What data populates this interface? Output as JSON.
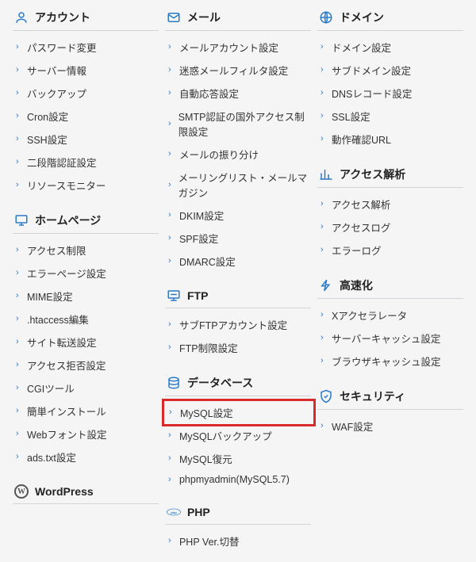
{
  "columns": [
    {
      "sections": [
        {
          "id": "account",
          "icon": "person",
          "title": "アカウント",
          "items": [
            "パスワード変更",
            "サーバー情報",
            "バックアップ",
            "Cron設定",
            "SSH設定",
            "二段階認証設定",
            "リソースモニター"
          ]
        },
        {
          "id": "homepage",
          "icon": "monitor",
          "title": "ホームページ",
          "items": [
            "アクセス制限",
            "エラーページ設定",
            "MIME設定",
            ".htaccess編集",
            "サイト転送設定",
            "アクセス拒否設定",
            "CGIツール",
            "簡単インストール",
            "Webフォント設定",
            "ads.txt設定"
          ]
        },
        {
          "id": "wordpress",
          "icon": "wordpress",
          "title": "WordPress",
          "items": []
        }
      ]
    },
    {
      "sections": [
        {
          "id": "mail",
          "icon": "mail",
          "title": "メール",
          "items": [
            "メールアカウント設定",
            "迷惑メールフィルタ設定",
            "自動応答設定",
            "SMTP認証の国外アクセス制限設定",
            "メールの振り分け",
            "メーリングリスト・メールマガジン",
            "DKIM設定",
            "SPF設定",
            "DMARC設定"
          ]
        },
        {
          "id": "ftp",
          "icon": "ftp",
          "title": "FTP",
          "items": [
            "サブFTPアカウント設定",
            "FTP制限設定"
          ]
        },
        {
          "id": "database",
          "icon": "database",
          "title": "データベース",
          "highlight_index": 0,
          "items": [
            "MySQL設定",
            "MySQLバックアップ",
            "MySQL復元",
            "phpmyadmin(MySQL5.7)"
          ]
        },
        {
          "id": "php",
          "icon": "php",
          "title": "PHP",
          "items": [
            "PHP Ver.切替"
          ]
        }
      ]
    },
    {
      "sections": [
        {
          "id": "domain",
          "icon": "globe",
          "title": "ドメイン",
          "items": [
            "ドメイン設定",
            "サブドメイン設定",
            "DNSレコード設定",
            "SSL設定",
            "動作確認URL"
          ]
        },
        {
          "id": "access",
          "icon": "chart",
          "title": "アクセス解析",
          "items": [
            "アクセス解析",
            "アクセスログ",
            "エラーログ"
          ]
        },
        {
          "id": "speed",
          "icon": "speed",
          "title": "高速化",
          "items": [
            "Xアクセラレータ",
            "サーバーキャッシュ設定",
            "ブラウザキャッシュ設定"
          ]
        },
        {
          "id": "security",
          "icon": "shield",
          "title": "セキュリティ",
          "items": [
            "WAF設定"
          ]
        }
      ]
    }
  ]
}
